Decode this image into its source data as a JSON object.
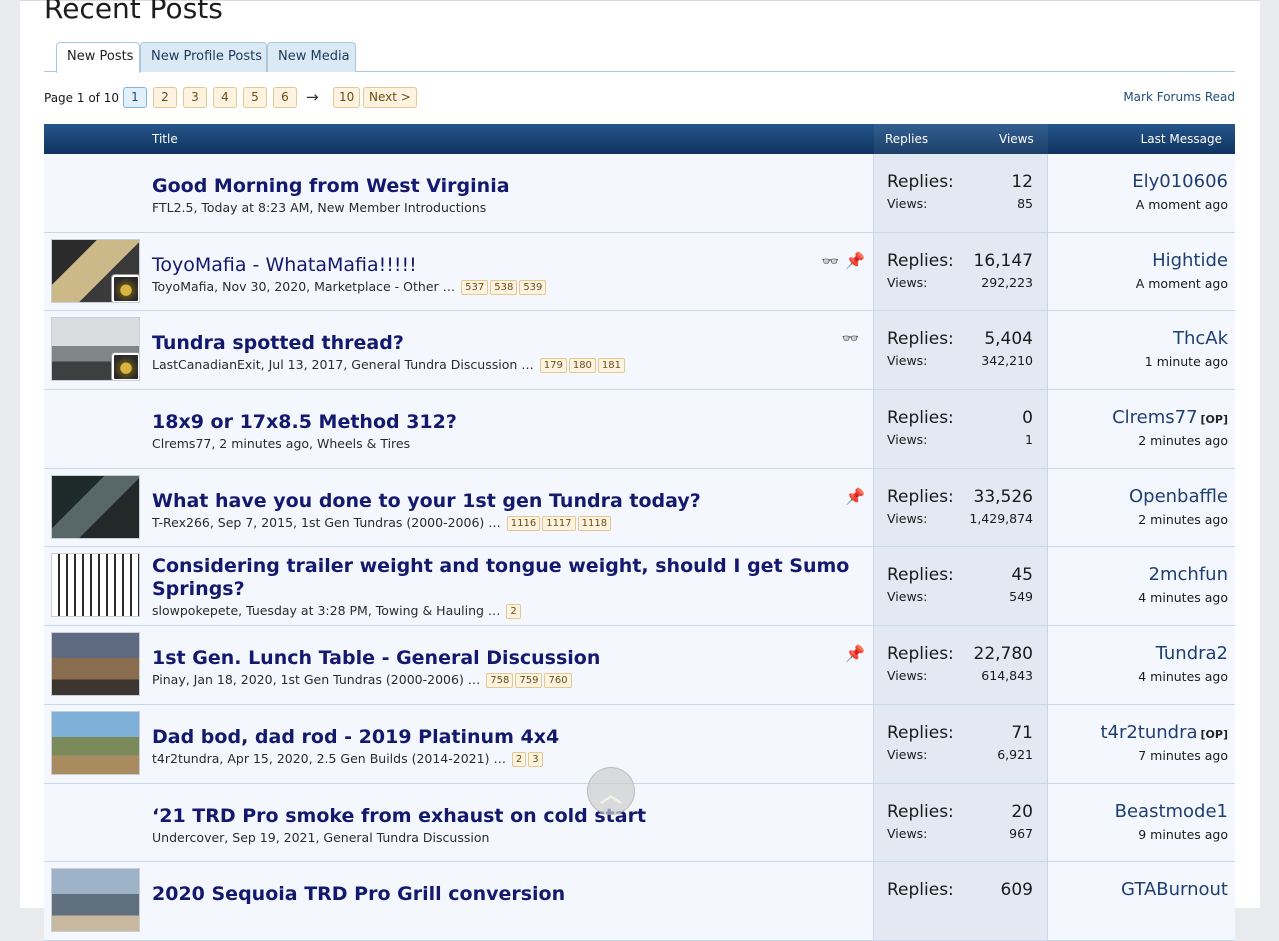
{
  "page_title": "Recent Posts",
  "tabs": [
    {
      "label": "New Posts",
      "active": true
    },
    {
      "label": "New Profile Posts",
      "active": false
    },
    {
      "label": "New Media",
      "active": false
    }
  ],
  "pagination": {
    "label": "Page 1 of 10",
    "pages": [
      "1",
      "2",
      "3",
      "4",
      "5",
      "6"
    ],
    "arrow": "→",
    "last": "10",
    "next": "Next >"
  },
  "mark_read": "Mark Forums Read",
  "headers": {
    "title": "Title",
    "replies": "Replies",
    "views": "Views",
    "last": "Last Message"
  },
  "labels": {
    "replies": "Replies:",
    "views": "Views:"
  },
  "threads": [
    {
      "title": "Good Morning from West Virginia",
      "meta": "FTL2.5, Today at 8:23 AM, New Member Introductions",
      "pages": [],
      "replies": "12",
      "views": "85",
      "last_user": "Ely010606",
      "op": "",
      "last_time": "A moment ago"
    },
    {
      "title": "ToyoMafia - WhataMafia!!!!!",
      "meta": "ToyoMafia, Nov 30, 2020, Marketplace - Other",
      "pages": [
        "537",
        "538",
        "539"
      ],
      "replies": "16,147",
      "views": "292,223",
      "last_user": "Hightide",
      "op": "",
      "last_time": "A moment ago"
    },
    {
      "title": "Tundra spotted thread?",
      "meta": "LastCanadianExit, Jul 13, 2017, General Tundra Discussion",
      "pages": [
        "179",
        "180",
        "181"
      ],
      "replies": "5,404",
      "views": "342,210",
      "last_user": "ThcAk",
      "op": "",
      "last_time": "1 minute ago"
    },
    {
      "title": "18x9 or 17x8.5 Method 312?",
      "meta": "Clrems77, 2 minutes ago, Wheels & Tires",
      "pages": [],
      "replies": "0",
      "views": "1",
      "last_user": "Clrems77",
      "op": "[OP]",
      "last_time": "2 minutes ago"
    },
    {
      "title": "What have you done to your 1st gen Tundra today?",
      "meta": "T-Rex266, Sep 7, 2015, 1st Gen Tundras (2000-2006)",
      "pages": [
        "1116",
        "1117",
        "1118"
      ],
      "replies": "33,526",
      "views": "1,429,874",
      "last_user": "Openbaffle",
      "op": "",
      "last_time": "2 minutes ago"
    },
    {
      "title": "Considering trailer weight and tongue weight, should I get Sumo Springs?",
      "meta": "slowpokepete, Tuesday at 3:28 PM, Towing & Hauling",
      "pages": [
        "2"
      ],
      "replies": "45",
      "views": "549",
      "last_user": "2mchfun",
      "op": "",
      "last_time": "4 minutes ago"
    },
    {
      "title": "1st Gen. Lunch Table - General Discussion",
      "meta": "Pinay, Jan 18, 2020, 1st Gen Tundras (2000-2006)",
      "pages": [
        "758",
        "759",
        "760"
      ],
      "replies": "22,780",
      "views": "614,843",
      "last_user": "Tundra2",
      "op": "",
      "last_time": "4 minutes ago"
    },
    {
      "title": "Dad bod, dad rod - 2019 Platinum 4x4",
      "meta": "t4r2tundra, Apr 15, 2020, 2.5 Gen Builds (2014-2021)",
      "pages": [
        "2",
        "3"
      ],
      "replies": "71",
      "views": "6,921",
      "last_user": "t4r2tundra",
      "op": "[OP]",
      "last_time": "7 minutes ago"
    },
    {
      "title": "‘21 TRD Pro smoke from exhaust on cold start",
      "meta": "Undercover, Sep 19, 2021, General Tundra Discussion",
      "pages": [],
      "replies": "20",
      "views": "967",
      "last_user": "Beastmode1",
      "op": "",
      "last_time": "9 minutes ago"
    },
    {
      "title": "2020 Sequoia TRD Pro Grill conversion",
      "meta": "",
      "pages": [],
      "replies": "609",
      "views": "",
      "last_user": "GTABurnout",
      "op": "",
      "last_time": ""
    }
  ],
  "icons": {
    "watched": "glasses-icon",
    "sticky": "pin-icon",
    "scroll_top": "chevron-up-icon"
  },
  "colors": {
    "header": "#0f3460",
    "title_link": "#131a6e",
    "user_link": "#1d3f73",
    "pin": "#d12b2b"
  }
}
